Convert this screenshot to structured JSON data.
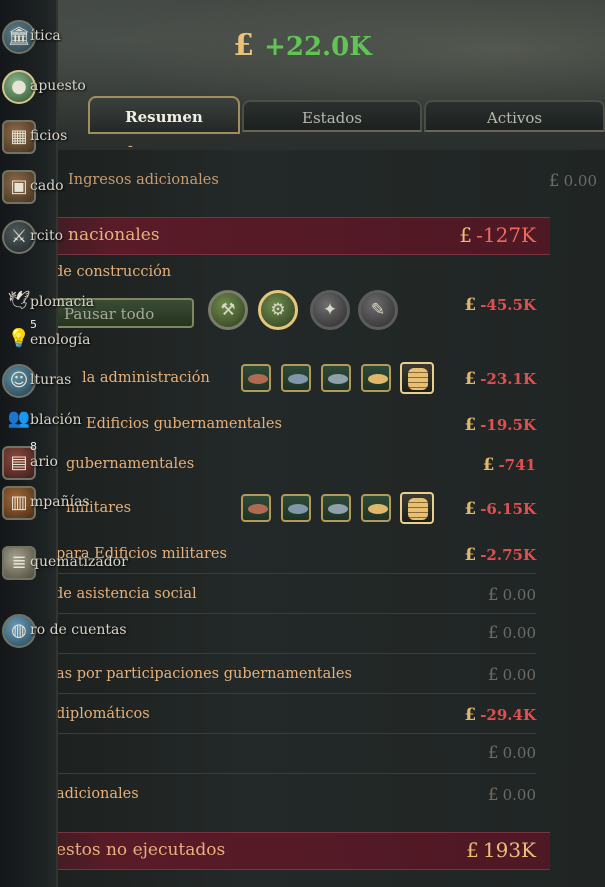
{
  "header": {
    "currency_symbol": "£",
    "balance": "+22.0K"
  },
  "tabs": [
    {
      "label": "Resumen",
      "active": true
    },
    {
      "label": "Estados",
      "active": false
    },
    {
      "label": "Activos",
      "active": false
    }
  ],
  "sidebar": {
    "items": [
      {
        "label": "ítica",
        "icon": "government-building-icon"
      },
      {
        "label": "apuesto",
        "icon": "coins-icon",
        "active": true
      },
      {
        "label": "ficios",
        "icon": "factory-icon"
      },
      {
        "label": "cado",
        "icon": "crate-icon"
      },
      {
        "label": "rcito",
        "icon": "crossed-swords-icon"
      },
      {
        "label": "plomacia",
        "icon": "dove-icon"
      },
      {
        "label": "enología",
        "icon": "lightbulb-icon",
        "badge": "5"
      },
      {
        "label": "lturas",
        "icon": "theatre-masks-icon"
      },
      {
        "label": "blación",
        "icon": "population-icon"
      },
      {
        "label": "ario",
        "icon": "journal-icon",
        "badge": "8"
      },
      {
        "label": "mpañías",
        "icon": "briefcase-icon"
      },
      {
        "label": "quematizador",
        "icon": "document-icon"
      },
      {
        "label": "ro de cuentas",
        "icon": "globe-icon"
      }
    ]
  },
  "rows": {
    "partial_top": "-",
    "ingresos_adicionales": {
      "label": "Ingresos adicionales",
      "value": "0.00"
    },
    "section_asignaciones": {
      "label": "nacionales",
      "value": "-127K"
    },
    "construccion": {
      "label": "de construcción",
      "value": "-45.5K"
    },
    "pause_all": "Pausar todo",
    "administracion": {
      "label": "la administración",
      "value": "-23.1K"
    },
    "edif_gubern": {
      "label": "Edificios gubernamentales",
      "value": "-19.5K"
    },
    "salario_gubern": {
      "label": "gubernamentales",
      "value": "-741"
    },
    "militares": {
      "label": "militares",
      "value": "-6.15K"
    },
    "edif_militares": {
      "label": "para Edificios militares",
      "value": "-2.75K"
    },
    "asistencia_social": {
      "label": "de asistencia social",
      "value": "0.00"
    },
    "cuentas": {
      "label": "ro de cuentas",
      "value": "0.00"
    },
    "participaciones": {
      "label": "as por participaciones gubernamentales",
      "value": "0.00"
    },
    "diplomaticos": {
      "label": "diplomáticos",
      "value": "-29.4K"
    },
    "blank_row": {
      "label": "",
      "value": "0.00"
    },
    "adicionales": {
      "label": "adicionales",
      "value": "0.00"
    },
    "section_no_ejecutados": {
      "label": "estos no ejecutados",
      "value": "193K"
    }
  },
  "currency_symbol": "£"
}
